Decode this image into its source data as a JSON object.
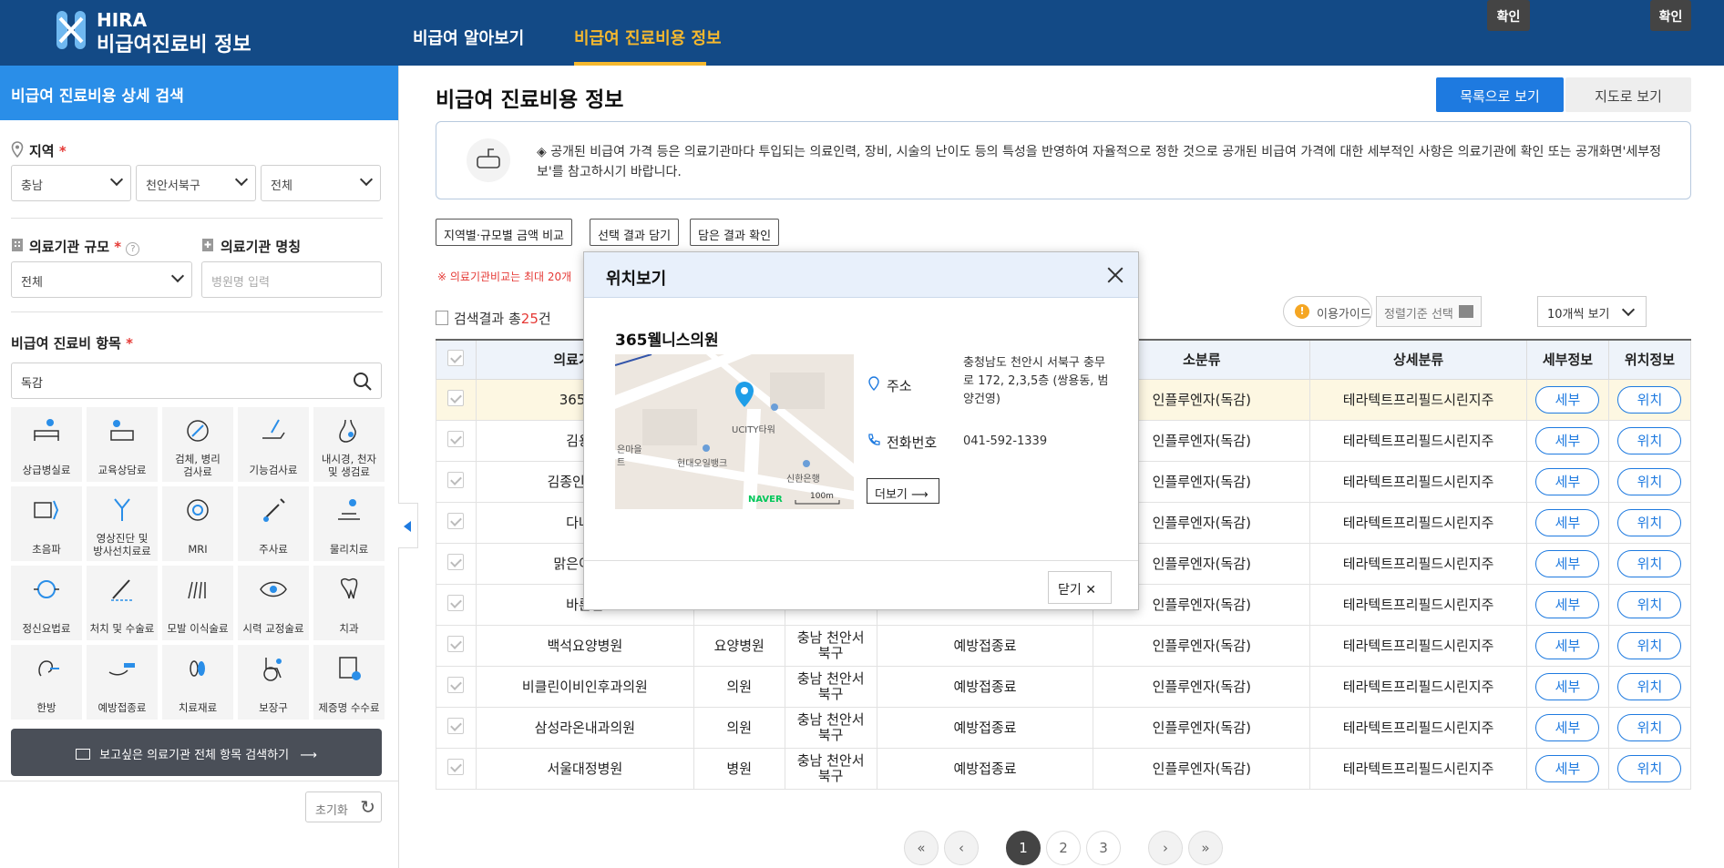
{
  "header": {
    "logo_line1": "HIRA",
    "logo_line2": "비급여진료비 정보",
    "nav": [
      "비급여 알아보기",
      "비급여 진료비용 정보"
    ]
  },
  "sidebar": {
    "title": "비급여 진료비용 상세 검색",
    "region_label": "지역",
    "region_values": [
      "충남",
      "천안서북구",
      "전체"
    ],
    "scale_label": "의료기관 규모",
    "scale_value": "전체",
    "name_label": "의료기관 명칭",
    "name_placeholder": "병원명 입력",
    "item_label": "비급여 진료비 항목",
    "item_search_value": "독감",
    "categories": [
      [
        "상급병실료",
        "교육상담료",
        "검체, 병리\n검사료",
        "기능검사료",
        "내시경, 천자\n및 생검료"
      ],
      [
        "초음파",
        "영상진단 및\n방사선치료료",
        "MRI",
        "주사료",
        "물리치료"
      ],
      [
        "정신요법료",
        "처치 및 수술료",
        "모발 이식술료",
        "시력 교정술료",
        "치과"
      ],
      [
        "한방",
        "예방접종료",
        "치료재료",
        "보장구",
        "제증명 수수료"
      ]
    ],
    "search_all_button": "보고싶은 의료기관 전체 항목 검색하기",
    "reset": "초기화"
  },
  "main": {
    "title": "비급여 진료비용 정보",
    "tab_list": "목록으로 보기",
    "tab_map": "지도로 보기",
    "notice": "◈ 공개된 비급여 가격 등은 의료기관마다 투입되는 의료인력, 장비, 시술의 난이도 등의 특성을 반영하여 자율적으로 정한 것으로 공개된 비급여 가격에 대한 세부적인 사항은 의료기관에 확인 또는 공개화면'세부정보'를 참고하시기 바랍니다.",
    "buttons": [
      "지역별·규모별 금액 비교",
      "선택 결과 담기",
      "담은 결과 확인"
    ],
    "compare_note": "※ 의료기관비교는 최대 20개",
    "result_prefix": "검색결과 총",
    "result_count": "25",
    "result_suffix": "건",
    "guide": "이용가이드",
    "sort_placeholder": "정렬기준 선택",
    "confirm": "확인",
    "per_page": "10개씩 보기",
    "columns": [
      "의료기관명",
      "",
      "",
      "",
      "소분류",
      "상세분류",
      "세부정보",
      "위치정보"
    ],
    "rows": [
      {
        "name": "365웰니",
        "type": "",
        "region": "",
        "cat": "",
        "sub": "인플루엔자(독감)",
        "detail": "테라텍트프리필드시린지주"
      },
      {
        "name": "김용현",
        "type": "",
        "region": "",
        "cat": "",
        "sub": "인플루엔자(독감)",
        "detail": "테라텍트프리필드시린지주"
      },
      {
        "name": "김종인소아청",
        "type": "",
        "region": "",
        "cat": "",
        "sub": "인플루엔자(독감)",
        "detail": "테라텍트프리필드시린지주"
      },
      {
        "name": "다나여",
        "type": "",
        "region": "",
        "cat": "",
        "sub": "인플루엔자(독감)",
        "detail": "테라텍트프리필드시린지주"
      },
      {
        "name": "맑은이비인",
        "type": "",
        "region": "",
        "cat": "",
        "sub": "인플루엔자(독감)",
        "detail": "테라텍트프리필드시린지주"
      },
      {
        "name": "바른한",
        "type": "",
        "region": "북구",
        "cat": "",
        "sub": "인플루엔자(독감)",
        "detail": "테라텍트프리필드시린지주"
      },
      {
        "name": "백석요양병원",
        "type": "요양병원",
        "region": "충남 천안서\n북구",
        "cat": "예방접종료",
        "sub": "인플루엔자(독감)",
        "detail": "테라텍트프리필드시린지주"
      },
      {
        "name": "비클린이비인후과의원",
        "type": "의원",
        "region": "충남 천안서\n북구",
        "cat": "예방접종료",
        "sub": "인플루엔자(독감)",
        "detail": "테라텍트프리필드시린지주"
      },
      {
        "name": "삼성라온내과의원",
        "type": "의원",
        "region": "충남 천안서\n북구",
        "cat": "예방접종료",
        "sub": "인플루엔자(독감)",
        "detail": "테라텍트프리필드시린지주"
      },
      {
        "name": "서울대정병원",
        "type": "병원",
        "region": "충남 천안서\n북구",
        "cat": "예방접종료",
        "sub": "인플루엔자(독감)",
        "detail": "테라텍트프리필드시린지주"
      }
    ],
    "detail_btn": "세부",
    "loc_btn": "위치",
    "pages": [
      "1",
      "2",
      "3"
    ]
  },
  "modal": {
    "title": "위치보기",
    "name": "365웰니스의원",
    "addr_label": "주소",
    "addr": "충청남도 천안시 서북구 충무로 172, 2,3,5층 (쌍용동, 범양건영)",
    "phone_label": "전화번호",
    "phone": "041-592-1339",
    "more": "더보기",
    "close": "닫기",
    "map_labels": {
      "ucity": "UCITY타워",
      "bank1": "현대오일뱅크",
      "bank2": "신한은행",
      "naver": "NAVER",
      "scale": "100m",
      "village": "은마을",
      "tower": "트"
    }
  },
  "colors": {
    "header": "#134a86",
    "accent": "#1e7ae0",
    "active_nav": "#f5b82e",
    "required": "#e53935"
  }
}
